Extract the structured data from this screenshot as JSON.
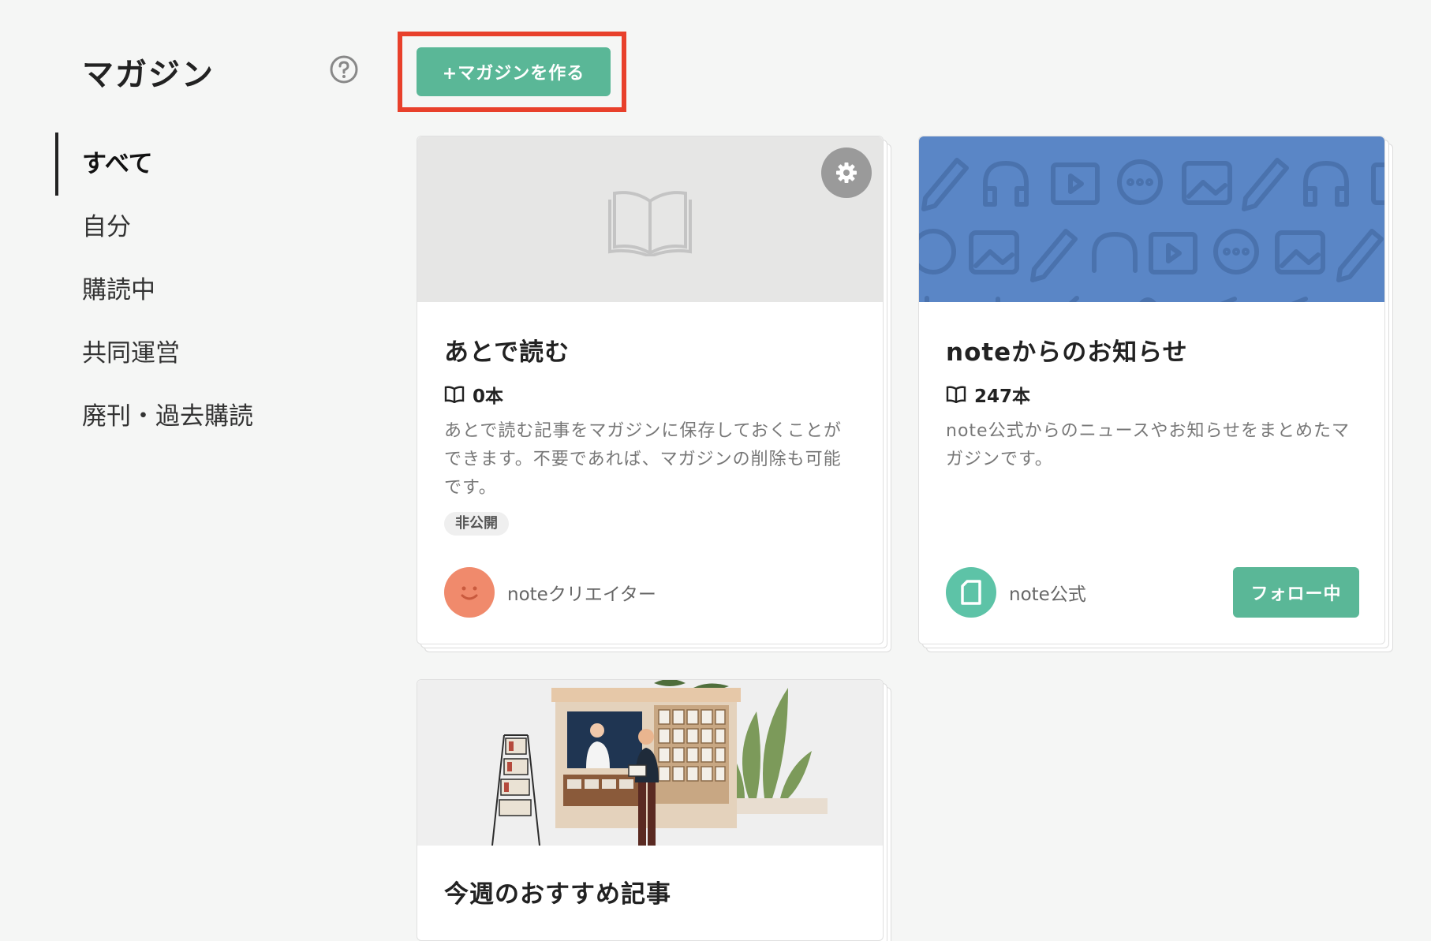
{
  "sidebar": {
    "title": "マガジン",
    "items": [
      {
        "label": "すべて",
        "active": true
      },
      {
        "label": "自分",
        "active": false
      },
      {
        "label": "購読中",
        "active": false
      },
      {
        "label": "共同運営",
        "active": false
      },
      {
        "label": "廃刊・過去購読",
        "active": false
      }
    ]
  },
  "header": {
    "create_label": "+マガジンを作る",
    "highlight_color": "#e8402b"
  },
  "cards": [
    {
      "title": "あとで読む",
      "count": "0本",
      "description": "あとで読む記事をマガジンに保存しておくことができます。不要であれば、マガジンの削除も可能です。",
      "badge": "非公開",
      "author": "noteクリエイター",
      "icons": [
        "book-icon",
        "gear-icon",
        "smiley-avatar-icon"
      ]
    },
    {
      "title": "noteからのお知らせ",
      "count": "247本",
      "description": "note公式からのニュースやお知らせをまとめたマガジンです。",
      "author": "note公式",
      "follow_label": "フォロー中",
      "icons": [
        "book-icon",
        "note-logo-icon"
      ]
    },
    {
      "title": "今週のおすすめ記事"
    }
  ],
  "colors": {
    "accent": "#5ab797",
    "cover_blue": "#5a86c6",
    "avatar_orange": "#f08a6c",
    "avatar_teal": "#5dc3a7"
  }
}
